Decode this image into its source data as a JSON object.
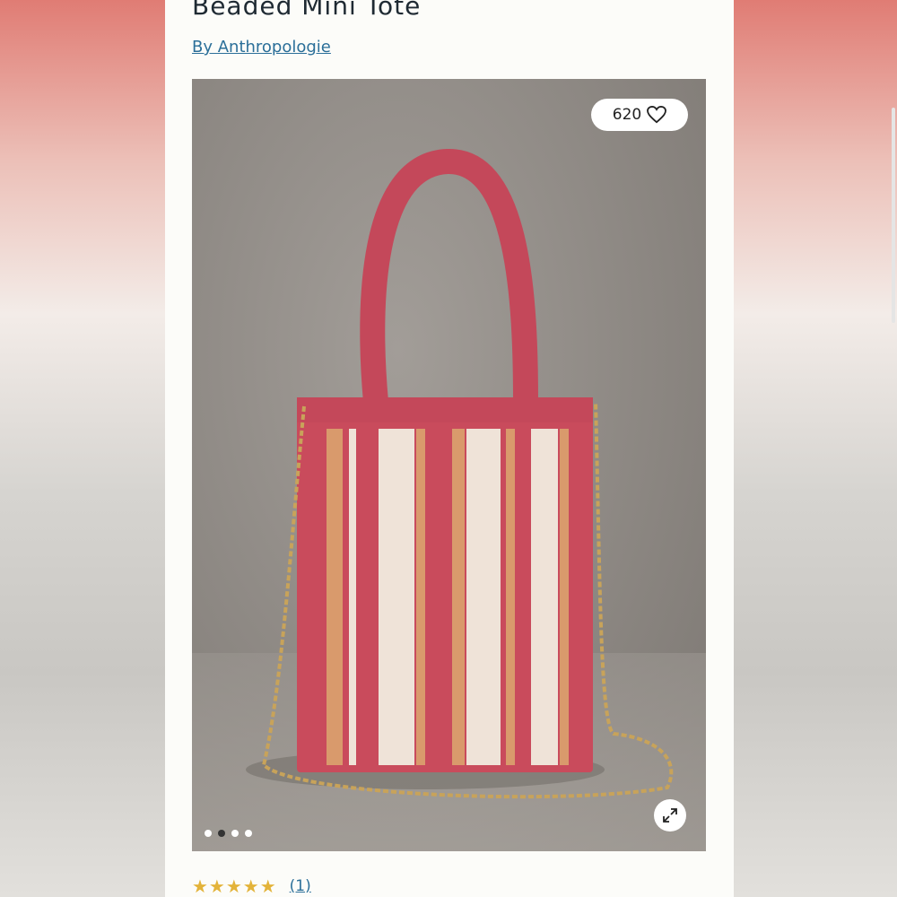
{
  "product": {
    "title": "Beaded Mini Tote",
    "brand_link": "By Anthropologie"
  },
  "gallery": {
    "like_count": "620",
    "image_count": 4,
    "active_index": 1,
    "icons": {
      "like": "heart-icon",
      "expand": "expand-icon"
    }
  },
  "rating": {
    "stars": "★★★★★",
    "value": 5,
    "review_count": "(1)"
  },
  "colors": {
    "link": "#2b6f99",
    "star": "#e3b33a",
    "bag_pink": "#c94b5c",
    "bag_cream": "#efe3d8",
    "bag_orange": "#d99a6c"
  }
}
